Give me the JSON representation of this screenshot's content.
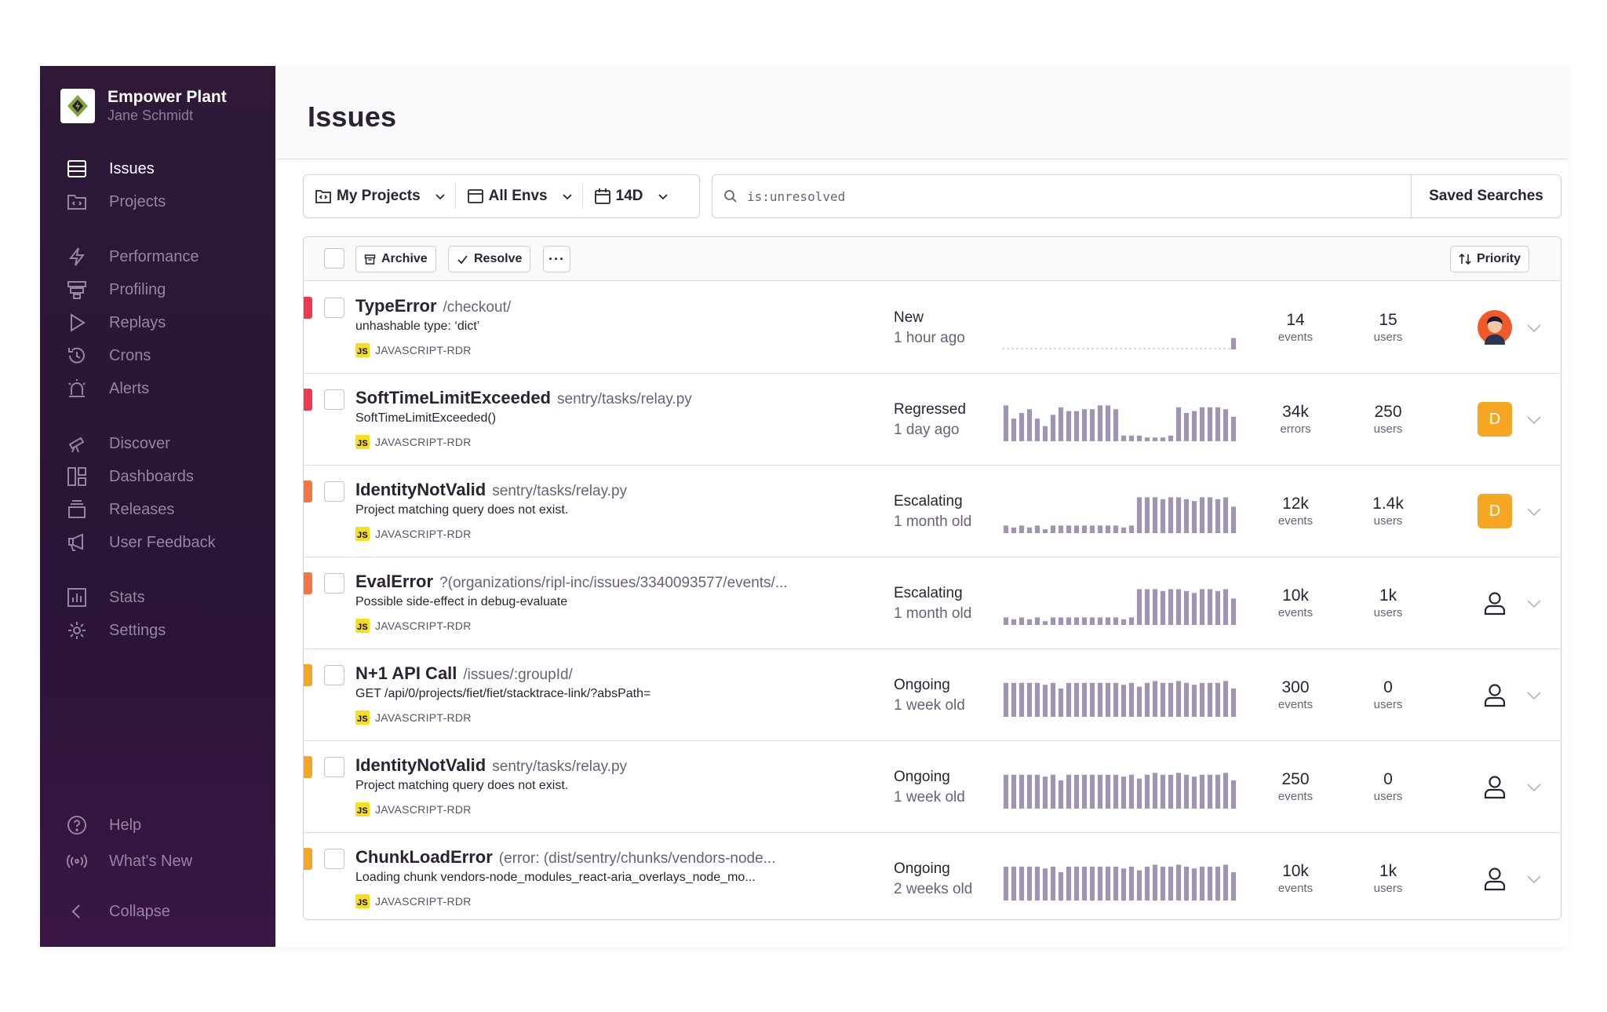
{
  "org": {
    "name": "Empower Plant",
    "user": "Jane Schmidt",
    "accent": "#7ea53a"
  },
  "nav": {
    "issues": "Issues",
    "projects": "Projects",
    "performance": "Performance",
    "profiling": "Profiling",
    "replays": "Replays",
    "crons": "Crons",
    "alerts": "Alerts",
    "discover": "Discover",
    "dashboards": "Dashboards",
    "releases": "Releases",
    "user_feedback": "User Feedback",
    "stats": "Stats",
    "settings": "Settings",
    "help": "Help",
    "whats_new": "What's New",
    "collapse": "Collapse"
  },
  "page": {
    "title": "Issues"
  },
  "filters": {
    "projects": "My Projects",
    "envs": "All Envs",
    "period": "14D"
  },
  "search": {
    "query": "is:unresolved",
    "saved_label": "Saved Searches"
  },
  "actions": {
    "archive": "Archive",
    "resolve": "Resolve",
    "more": "···",
    "sort": "Priority"
  },
  "colors": {
    "high": "#f0394e",
    "medium": "#f5773f",
    "low": "#f5a623",
    "bar": "#a193b3"
  },
  "issues": [
    {
      "title": "TypeError",
      "location": "/checkout/",
      "message": "unhashable type: ‘dict’",
      "project": "JAVASCRIPT-RDR",
      "status": "New",
      "age": "1 hour ago",
      "count": "14",
      "count_label": "events",
      "users": "15",
      "users_label": "users",
      "priority": "high",
      "assignee": "avatar",
      "spark": [
        0,
        0,
        0,
        0,
        0,
        0,
        0,
        0,
        0,
        0,
        0,
        0,
        0,
        0,
        0,
        0,
        0,
        0,
        0,
        0,
        0,
        0,
        0,
        0,
        0,
        0,
        0,
        0,
        0,
        0.3
      ]
    },
    {
      "title": "SoftTimeLimitExceeded",
      "location": "sentry/tasks/relay.py",
      "message": "SoftTimeLimitExceeded()",
      "project": "JAVASCRIPT-RDR",
      "status": "Regressed",
      "age": "1 day ago",
      "count": "34k",
      "count_label": "errors",
      "users": "250",
      "users_label": "users",
      "priority": "high",
      "assignee": "D",
      "spark": [
        0.95,
        0.6,
        0.75,
        0.85,
        0.6,
        0.4,
        0.7,
        0.9,
        0.8,
        0.8,
        0.85,
        0.85,
        0.95,
        0.95,
        0.85,
        0.15,
        0.15,
        0.15,
        0.1,
        0.1,
        0.1,
        0.15,
        0.9,
        0.75,
        0.8,
        0.9,
        0.9,
        0.9,
        0.85,
        0.65
      ]
    },
    {
      "title": "IdentityNotValid",
      "location": "sentry/tasks/relay.py",
      "message": "Project matching query does not exist.",
      "project": "JAVASCRIPT-RDR",
      "status": "Escalating",
      "age": "1 month old",
      "count": "12k",
      "count_label": "events",
      "users": "1.4k",
      "users_label": "users",
      "priority": "medium",
      "assignee": "D",
      "spark": [
        0.2,
        0.15,
        0.2,
        0.15,
        0.2,
        0.1,
        0.2,
        0.2,
        0.2,
        0.2,
        0.2,
        0.2,
        0.2,
        0.2,
        0.2,
        0.15,
        0.2,
        0.95,
        0.95,
        0.95,
        0.9,
        0.95,
        0.95,
        0.9,
        0.85,
        0.95,
        0.95,
        0.9,
        0.95,
        0.7
      ]
    },
    {
      "title": "EvalError",
      "location": "?(organizations/ripl-inc/issues/3340093577/events/...",
      "message": "Possible side-effect in debug-evaluate",
      "project": "JAVASCRIPT-RDR",
      "status": "Escalating",
      "age": "1 month old",
      "count": "10k",
      "count_label": "events",
      "users": "1k",
      "users_label": "users",
      "priority": "medium",
      "assignee": "none",
      "spark": [
        0.2,
        0.15,
        0.2,
        0.15,
        0.2,
        0.1,
        0.2,
        0.2,
        0.2,
        0.2,
        0.2,
        0.2,
        0.2,
        0.2,
        0.2,
        0.15,
        0.2,
        0.95,
        0.95,
        0.95,
        0.9,
        0.95,
        0.95,
        0.9,
        0.85,
        0.95,
        0.95,
        0.9,
        0.95,
        0.7
      ]
    },
    {
      "title": "N+1 API Call",
      "location": "/issues/:groupId/",
      "message": "GET /api/0/projects/fiet/fiet/stacktrace-link/?absPath=",
      "project": "JAVASCRIPT-RDR",
      "status": "Ongoing",
      "age": "1 week old",
      "count": "300",
      "count_label": "events",
      "users": "0",
      "users_label": "users",
      "priority": "low",
      "assignee": "none",
      "spark": [
        0.9,
        0.9,
        0.9,
        0.9,
        0.9,
        0.85,
        0.9,
        0.75,
        0.9,
        0.9,
        0.9,
        0.9,
        0.9,
        0.9,
        0.9,
        0.85,
        0.9,
        0.8,
        0.9,
        0.95,
        0.9,
        0.9,
        0.95,
        0.9,
        0.85,
        0.9,
        0.9,
        0.9,
        0.95,
        0.75
      ]
    },
    {
      "title": "IdentityNotValid",
      "location": "sentry/tasks/relay.py",
      "message": "Project matching query does not exist.",
      "project": "JAVASCRIPT-RDR",
      "status": "Ongoing",
      "age": "1 week old",
      "count": "250",
      "count_label": "events",
      "users": "0",
      "users_label": "users",
      "priority": "low",
      "assignee": "none",
      "spark": [
        0.9,
        0.9,
        0.9,
        0.9,
        0.9,
        0.85,
        0.9,
        0.75,
        0.9,
        0.9,
        0.9,
        0.9,
        0.9,
        0.9,
        0.9,
        0.85,
        0.9,
        0.8,
        0.9,
        0.95,
        0.9,
        0.9,
        0.95,
        0.9,
        0.85,
        0.9,
        0.9,
        0.9,
        0.95,
        0.75
      ]
    },
    {
      "title": "ChunkLoadError",
      "location": "(error: (dist/sentry/chunks/vendors-node...",
      "message": "Loading chunk vendors-node_modules_react-aria_overlays_node_mo...",
      "project": "JAVASCRIPT-RDR",
      "status": "Ongoing",
      "age": "2 weeks old",
      "count": "10k",
      "count_label": "events",
      "users": "1k",
      "users_label": "users",
      "priority": "low",
      "assignee": "none",
      "spark": [
        0.9,
        0.9,
        0.9,
        0.9,
        0.9,
        0.85,
        0.9,
        0.75,
        0.9,
        0.9,
        0.9,
        0.9,
        0.9,
        0.9,
        0.9,
        0.85,
        0.9,
        0.8,
        0.9,
        0.95,
        0.9,
        0.9,
        0.95,
        0.9,
        0.85,
        0.9,
        0.9,
        0.9,
        0.95,
        0.75
      ]
    }
  ]
}
